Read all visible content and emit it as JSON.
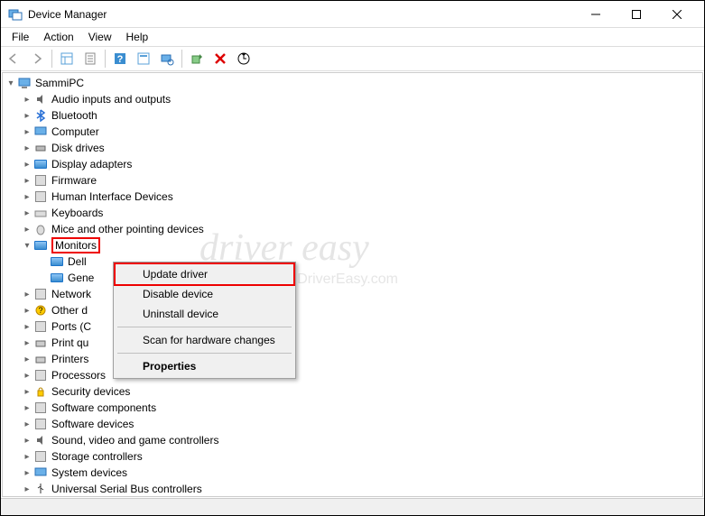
{
  "window": {
    "title": "Device Manager"
  },
  "menubar": [
    "File",
    "Action",
    "View",
    "Help"
  ],
  "tree": {
    "root": "SammiPC",
    "categories": [
      "Audio inputs and outputs",
      "Bluetooth",
      "Computer",
      "Disk drives",
      "Display adapters",
      "Firmware",
      "Human Interface Devices",
      "Keyboards",
      "Mice and other pointing devices",
      "Monitors",
      "Network adapters",
      "Other devices",
      "Ports (COM & LPT)",
      "Print queues",
      "Printers",
      "Processors",
      "Security devices",
      "Software components",
      "Software devices",
      "Sound, video and game controllers",
      "Storage controllers",
      "System devices",
      "Universal Serial Bus controllers"
    ],
    "monitors_children": [
      "Dell",
      "Generic PnP Monitor"
    ],
    "truncated": {
      "network": "Network",
      "other": "Other d",
      "ports": "Ports (C",
      "printq": "Print qu",
      "printers": "Printers",
      "dell": "Dell",
      "gene": "Gene"
    }
  },
  "context_menu": {
    "items": [
      "Update driver",
      "Disable device",
      "Uninstall device",
      "Scan for hardware changes",
      "Properties"
    ]
  },
  "watermark": {
    "main": "driver easy",
    "sub": "www.DriverEasy.com"
  }
}
